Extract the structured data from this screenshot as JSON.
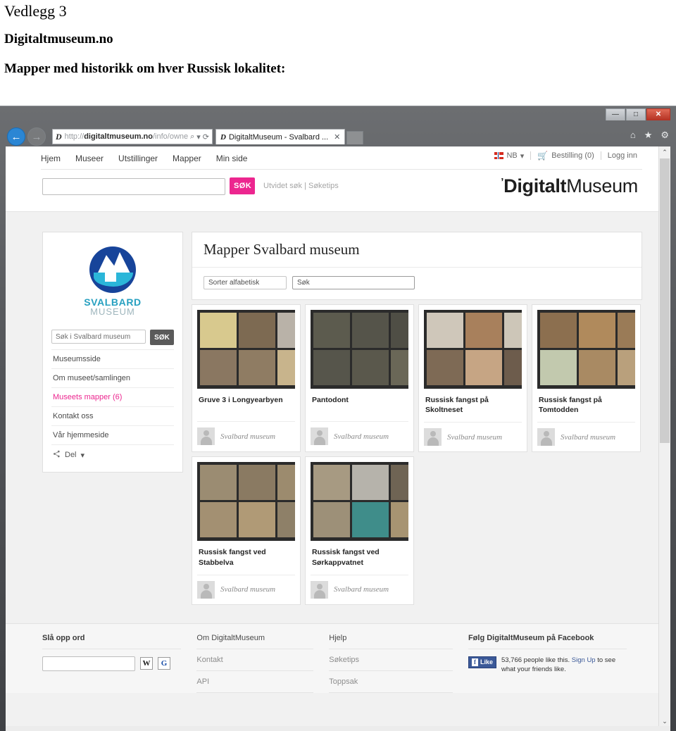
{
  "document": {
    "attachment_label": "Vedlegg 3",
    "site_heading": "Digitaltmuseum.no",
    "subheading": "Mapper med historikk om hver Russisk lokalitet:"
  },
  "browser": {
    "window_controls": {
      "minimize": "—",
      "maximize": "□",
      "close": "✕"
    },
    "back_icon": "←",
    "forward_icon": "→",
    "address": {
      "scheme": "http://",
      "host": "digitaltmuseum.no",
      "path": "/info/owner",
      "search_icon": "⌕",
      "dropdown_icon": "▾",
      "refresh_icon": "⟳",
      "favicon_label": "D"
    },
    "tab": {
      "favicon_label": "D",
      "title": "DigitaltMuseum - Svalbard ...",
      "close_icon": "✕"
    },
    "toolbar_icons": {
      "home": "⌂",
      "favorites": "★",
      "settings": "⚙"
    }
  },
  "site": {
    "nav": [
      "Hjem",
      "Museer",
      "Utstillinger",
      "Mapper",
      "Min side"
    ],
    "language": {
      "label": "NB",
      "caret": "▾"
    },
    "cart": {
      "icon": "Ὥ2",
      "label": "Bestilling (0)"
    },
    "login": "Logg inn",
    "search": {
      "value": "",
      "placeholder": "",
      "button": "SØK",
      "links": "Utvidet søk | Søketips"
    },
    "logo": {
      "tick": "’",
      "bold": "Digitalt",
      "light": "Museum"
    }
  },
  "sidebar": {
    "museum_logo": {
      "line1": "SVALBARD",
      "line2": "MUSEUM"
    },
    "search": {
      "placeholder": "Søk i Svalbard museum",
      "value": "",
      "button": "SØK"
    },
    "links": [
      {
        "label": "Museumsside",
        "active": false
      },
      {
        "label": "Om museet/samlingen",
        "active": false
      },
      {
        "label": "Museets mapper (6)",
        "active": true
      },
      {
        "label": "Kontakt oss",
        "active": false
      },
      {
        "label": "Vår hjemmeside",
        "active": false
      }
    ],
    "share": {
      "icon": "≪",
      "label": "Del",
      "caret": "▾"
    }
  },
  "panel": {
    "title": "Mapper Svalbard museum",
    "sort_button": "Sorter alfabetisk",
    "find_input": {
      "value": "",
      "placeholder": "Søk"
    }
  },
  "cards": [
    {
      "title": "Gruve 3 i Longyearbyen",
      "owner": "Svalbard museum",
      "thumbs": [
        "#d8c98e",
        "#7d6a52",
        "#b9b2a8",
        "#8a7761",
        "#8f7c63",
        "#c8b48c"
      ]
    },
    {
      "title": "Pantodont",
      "owner": "Svalbard museum",
      "thumbs": [
        "#5c5b4e",
        "#55544a",
        "#4f4e45",
        "#56554b",
        "#5a584c",
        "#6a6757"
      ]
    },
    {
      "title": "Russisk fangst på Skoltneset",
      "owner": "Svalbard museum",
      "thumbs": [
        "#cfc7ba",
        "#a8805c",
        "#cdc6b8",
        "#7e6a55",
        "#c6a584",
        "#6d5c4c"
      ]
    },
    {
      "title": "Russisk fangst på Tomtodden",
      "owner": "Svalbard museum",
      "thumbs": [
        "#8c6f4f",
        "#b08a5c",
        "#9a7b57",
        "#c2c9ae",
        "#a98a63",
        "#b9a07c"
      ]
    },
    {
      "title": "Russisk fangst ved Stabbelva",
      "owner": "Svalbard museum",
      "thumbs": [
        "#9b8c72",
        "#8a7a62",
        "#9c8b6e",
        "#a39072",
        "#b09a76",
        "#8e8068"
      ]
    },
    {
      "title": "Russisk fangst ved Sørkappvatnet",
      "owner": "Svalbard museum",
      "thumbs": [
        "#a79a82",
        "#b6b3ab",
        "#6f6454",
        "#9d9078",
        "#3f8d8a",
        "#a79472"
      ]
    }
  ],
  "footer": {
    "lookup": {
      "heading": "Slå opp ord",
      "value": "",
      "wiki_button": "W",
      "google_button": "G"
    },
    "col_about": [
      "Om DigitaltMuseum",
      "Kontakt",
      "API"
    ],
    "col_help": [
      "Hjelp",
      "Søketips",
      "Toppsak"
    ],
    "facebook": {
      "heading": "Følg DigitaltMuseum på Facebook",
      "like_label": "Like",
      "like_icon": "f",
      "count_text": "53,766 people like this.",
      "signup_text": "Sign Up",
      "tail_text": " to see what your friends like."
    }
  },
  "scrollbar": {
    "up": "⌃",
    "down": "⌄"
  },
  "colors": {
    "accent_pink": "#ec268f",
    "logo_blue": "#17449a",
    "logo_cyan": "#2bb6d9",
    "facebook_blue": "#3b5998"
  }
}
